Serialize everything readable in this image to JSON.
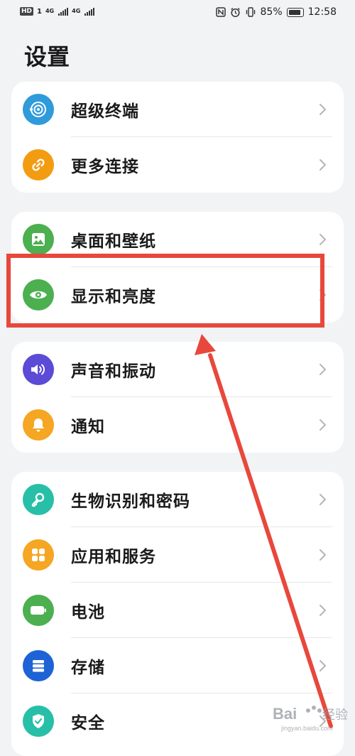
{
  "status_bar": {
    "hd_badge": "HD",
    "sim1": "1",
    "network1": "4G",
    "network2": "4G",
    "battery_percent": "85%",
    "time": "12:58"
  },
  "page": {
    "title": "设置"
  },
  "groups": [
    {
      "items": [
        {
          "label": "超级终端",
          "icon": "super-device-icon",
          "color": "#2f9bdb"
        },
        {
          "label": "更多连接",
          "icon": "link-icon",
          "color": "#f39c12"
        }
      ]
    },
    {
      "items": [
        {
          "label": "桌面和壁纸",
          "icon": "wallpaper-icon",
          "color": "#4caf50"
        },
        {
          "label": "显示和亮度",
          "icon": "eye-icon",
          "color": "#4caf50"
        }
      ]
    },
    {
      "items": [
        {
          "label": "声音和振动",
          "icon": "speaker-icon",
          "color": "#5b4bd6"
        },
        {
          "label": "通知",
          "icon": "bell-icon",
          "color": "#f5a623"
        }
      ]
    },
    {
      "items": [
        {
          "label": "生物识别和密码",
          "icon": "key-icon",
          "color": "#27bfa8"
        },
        {
          "label": "应用和服务",
          "icon": "apps-icon",
          "color": "#f5a623"
        },
        {
          "label": "电池",
          "icon": "battery-icon",
          "color": "#4caf50"
        },
        {
          "label": "存储",
          "icon": "storage-icon",
          "color": "#1e63d6"
        },
        {
          "label": "安全",
          "icon": "shield-icon",
          "color": "#27bfa8"
        }
      ]
    }
  ],
  "annotation": {
    "highlight_color": "#e8483c"
  },
  "watermark": {
    "text": "Bai经验",
    "subtext": "jingyan.baidu.com"
  }
}
